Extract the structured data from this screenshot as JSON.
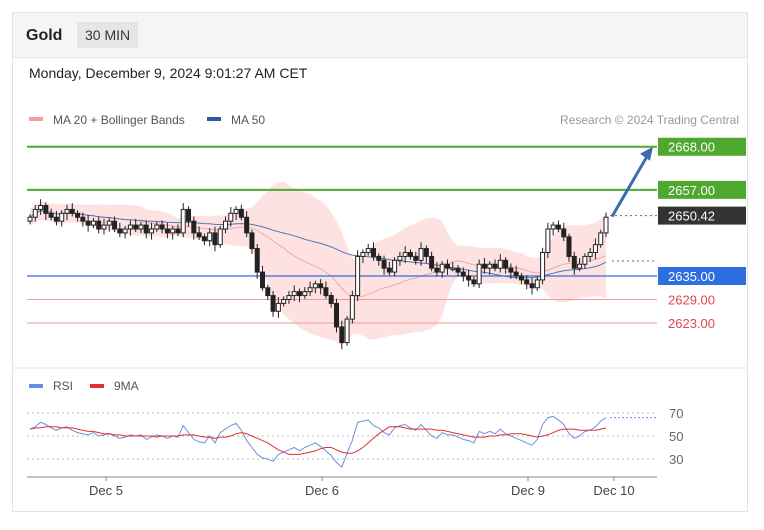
{
  "header": {
    "title": "Gold",
    "timeframe": "30 MIN"
  },
  "datetime": "Monday, December 9, 2024 9:01:27 AM CET",
  "legend": {
    "ma20": "MA 20 + Bollinger Bands",
    "ma50": "MA 50",
    "credit": "Research © 2024 Trading Central"
  },
  "rsi_legend": {
    "rsi": "RSI",
    "ma": "9MA"
  },
  "colors": {
    "green": "#4ea72e",
    "blue": "#2d6fe0",
    "red": "#e0474c",
    "current": "#333333",
    "up": "#ffffff",
    "down": "#222222",
    "band": "#fdd8d8",
    "ma50": "#4a78b5",
    "ma20": "#f0a8a8",
    "rsi": "#6b8fe0",
    "rsi_ma": "#e03030"
  },
  "chart_data": [
    {
      "type": "candlestick",
      "title": "Gold",
      "timeframe": "30 MIN",
      "x_ticks": [
        "Dec 5",
        "Dec 6",
        "Dec 9",
        "Dec 10"
      ],
      "levels": [
        {
          "value": 2668.0,
          "label": "2668.00",
          "kind": "target"
        },
        {
          "value": 2657.0,
          "label": "2657.00",
          "kind": "target"
        },
        {
          "value": 2650.42,
          "label": "2650.42",
          "kind": "current"
        },
        {
          "value": 2635.0,
          "label": "2635.00",
          "kind": "pivot"
        },
        {
          "value": 2629.0,
          "label": "2629.00",
          "kind": "support"
        },
        {
          "value": 2623.0,
          "label": "2623.00",
          "kind": "support"
        }
      ],
      "series": [
        {
          "name": "MA 20 + Bollinger Bands"
        },
        {
          "name": "MA 50"
        }
      ],
      "close": [
        2650,
        2652,
        2653,
        2651,
        2650,
        2649,
        2651,
        2652,
        2651,
        2650,
        2649,
        2648,
        2649,
        2647,
        2648,
        2649,
        2647,
        2646,
        2647,
        2648,
        2647,
        2648,
        2646,
        2647,
        2648,
        2647,
        2646,
        2647,
        2646,
        2652,
        2649,
        2646,
        2645,
        2644,
        2646,
        2643,
        2647,
        2649,
        2651,
        2652,
        2650,
        2646,
        2642,
        2636,
        2632,
        2630,
        2626,
        2628,
        2629,
        2630,
        2631,
        2630,
        2631,
        2632,
        2633,
        2632,
        2630,
        2628,
        2622,
        2618,
        2624,
        2630,
        2640,
        2641,
        2642,
        2640,
        2639,
        2637,
        2636,
        2639,
        2640,
        2641,
        2640,
        2639,
        2642,
        2640,
        2637,
        2636,
        2638,
        2637,
        2637,
        2636,
        2635,
        2634,
        2633,
        2638,
        2637,
        2638,
        2637,
        2639,
        2637,
        2636,
        2635,
        2634,
        2633,
        2632,
        2634,
        2641,
        2647,
        2648,
        2647,
        2645,
        2640,
        2637,
        2638,
        2640,
        2641,
        2643,
        2646,
        2650
      ],
      "rsi_ticks": [
        70,
        50,
        30
      ],
      "rsi": [
        56,
        58,
        62,
        60,
        57,
        55,
        57,
        58,
        55,
        53,
        52,
        51,
        53,
        50,
        51,
        52,
        50,
        48,
        49,
        51,
        50,
        51,
        47,
        49,
        51,
        50,
        48,
        50,
        49,
        59,
        53,
        47,
        45,
        44,
        50,
        44,
        53,
        56,
        59,
        61,
        55,
        46,
        40,
        34,
        31,
        30,
        28,
        34,
        36,
        38,
        40,
        37,
        40,
        42,
        44,
        41,
        37,
        33,
        27,
        23,
        35,
        46,
        62,
        63,
        64,
        59,
        57,
        53,
        51,
        57,
        59,
        60,
        57,
        55,
        60,
        55,
        50,
        48,
        53,
        51,
        51,
        49,
        47,
        46,
        44,
        54,
        52,
        54,
        52,
        56,
        52,
        50,
        48,
        46,
        44,
        42,
        47,
        60,
        66,
        67,
        64,
        60,
        52,
        48,
        50,
        54,
        55,
        58,
        63,
        66
      ],
      "rsi_ma": [
        56,
        57,
        57,
        58,
        58,
        58,
        57,
        57,
        57,
        56,
        55,
        54,
        54,
        53,
        52,
        52,
        51,
        51,
        50,
        50,
        50,
        50,
        50,
        50,
        49,
        50,
        50,
        50,
        50,
        51,
        51,
        51,
        50,
        49,
        49,
        48,
        49,
        49,
        50,
        52,
        53,
        52,
        50,
        48,
        46,
        44,
        41,
        38,
        36,
        34,
        34,
        34,
        35,
        36,
        37,
        39,
        40,
        40,
        38,
        36,
        35,
        35,
        37,
        40,
        44,
        48,
        52,
        55,
        58,
        58,
        58,
        57,
        56,
        56,
        56,
        56,
        56,
        55,
        55,
        54,
        53,
        52,
        51,
        50,
        49,
        49,
        49,
        50,
        50,
        51,
        51,
        52,
        52,
        52,
        51,
        50,
        49,
        50,
        51,
        53,
        55,
        56,
        56,
        56,
        55,
        55,
        55,
        55,
        56,
        57
      ]
    }
  ]
}
